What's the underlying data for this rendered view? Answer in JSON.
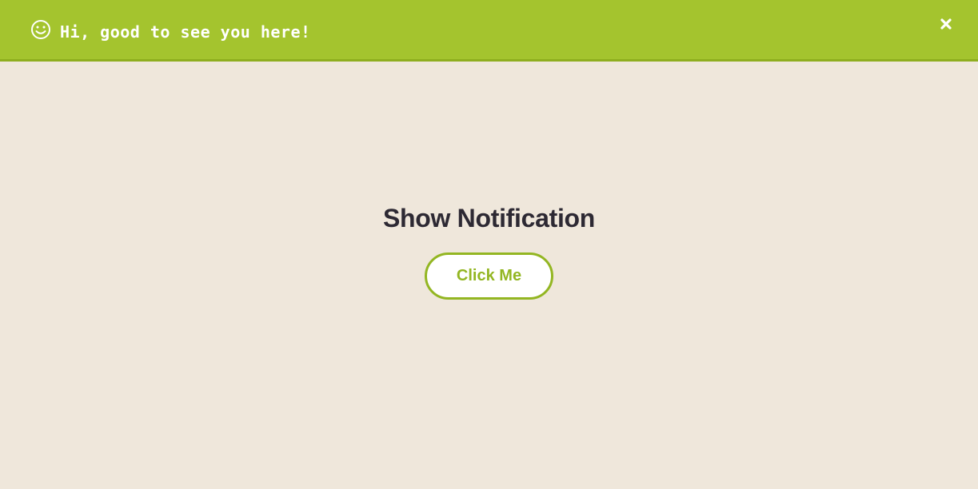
{
  "notification": {
    "icon": "smiley-icon",
    "message": "Hi, good to see you here!",
    "close_icon": "close-icon",
    "background_color": "#a4c42e"
  },
  "main": {
    "heading": "Show Notification",
    "button_label": "Click Me",
    "accent_color": "#93b622",
    "background_color": "#efe7db"
  }
}
